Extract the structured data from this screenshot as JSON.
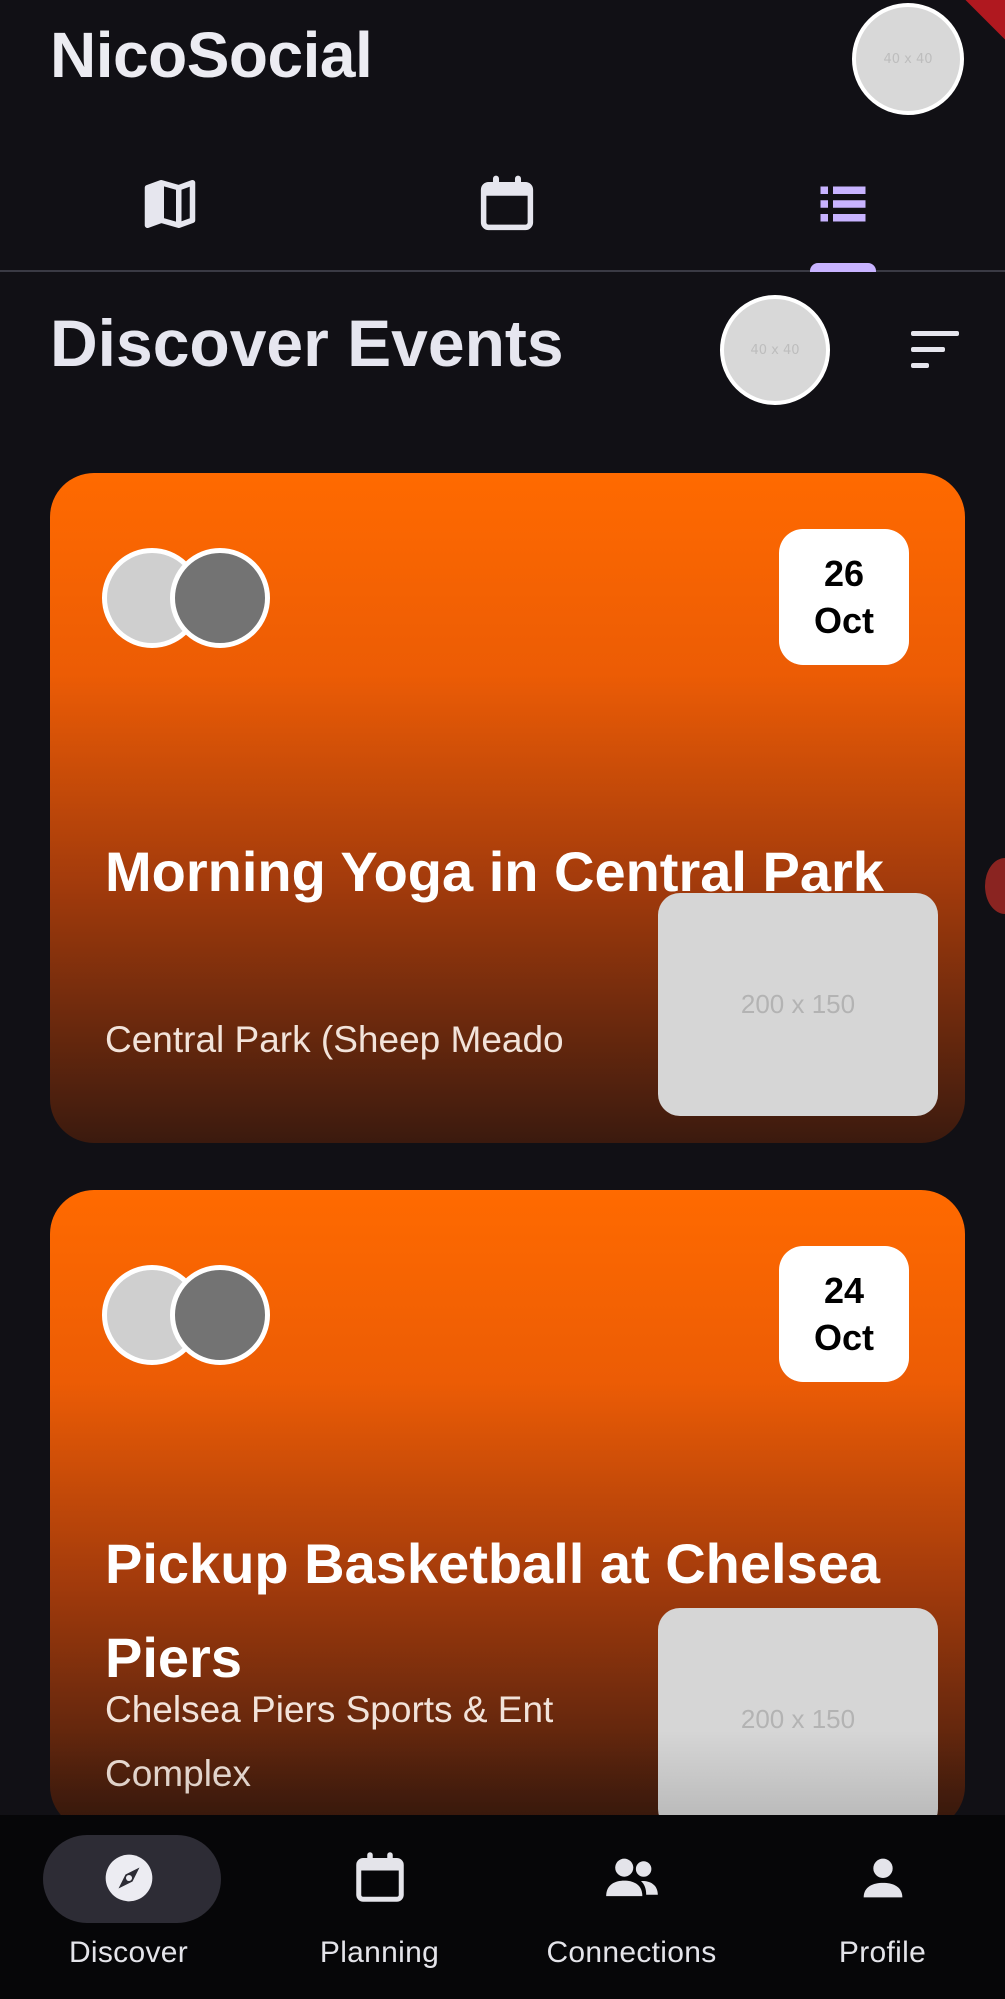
{
  "app": {
    "title": "NicoSocial"
  },
  "header": {
    "avatar_placeholder": "40 x 40"
  },
  "top_tabs": [
    {
      "icon": "map-icon",
      "selected": false
    },
    {
      "icon": "calendar-icon",
      "selected": false
    },
    {
      "icon": "list-icon",
      "selected": true
    }
  ],
  "section": {
    "title": "Discover Events",
    "avatar_placeholder": "40 x 40",
    "sort_icon": "sort-icon"
  },
  "events": [
    {
      "date_day": "26",
      "date_month": "Oct",
      "title": "Morning Yoga in Central Park",
      "location": "Central Park (Sheep Meado",
      "image_placeholder": "200 x 150"
    },
    {
      "date_day": "24",
      "date_month": "Oct",
      "title": "Pickup Basketball at Chelsea Piers",
      "location": "Chelsea Piers Sports & Ent Complex",
      "image_placeholder": "200 x 150"
    }
  ],
  "bottom_nav": [
    {
      "label": "Discover",
      "icon": "compass-icon",
      "selected": true
    },
    {
      "label": "Planning",
      "icon": "calendar-icon",
      "selected": false
    },
    {
      "label": "Connections",
      "icon": "people-icon",
      "selected": false
    },
    {
      "label": "Profile",
      "icon": "person-icon",
      "selected": false
    }
  ],
  "colors": {
    "accent": "#c8b3ff",
    "card_start": "#ff6a00",
    "card_end": "#3b1a0e",
    "background": "#111015"
  }
}
